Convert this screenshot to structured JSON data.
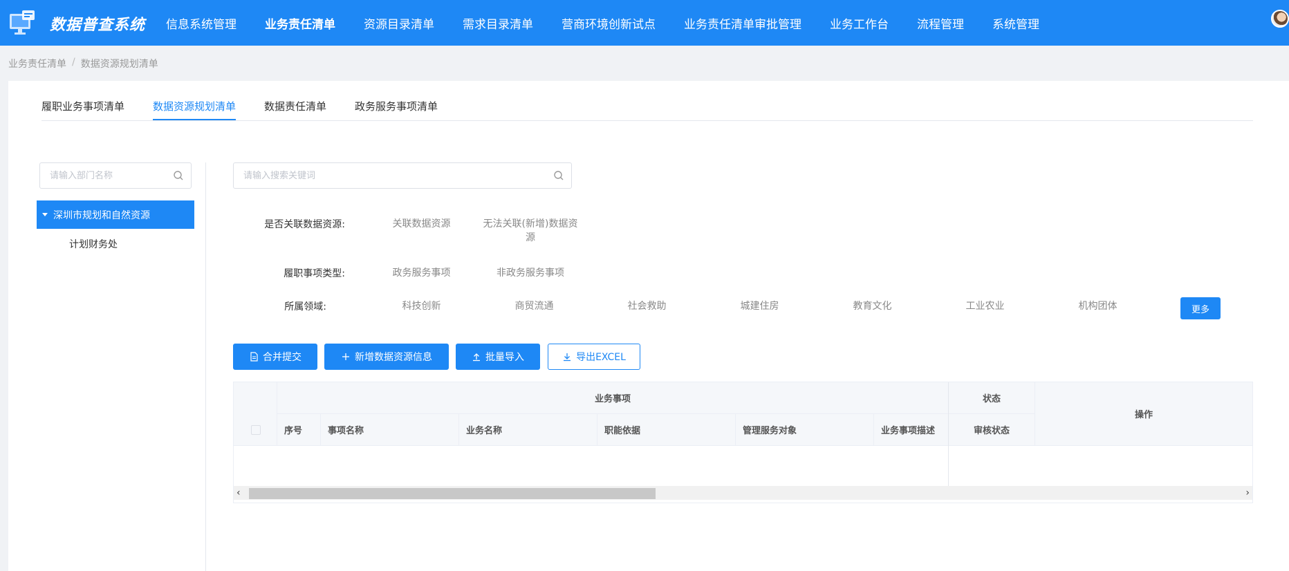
{
  "app": {
    "title": "数据普查系统"
  },
  "nav": [
    "信息系统管理",
    "业务责任清单",
    "资源目录清单",
    "需求目录清单",
    "营商环境创新试点",
    "业务责任清单审批管理",
    "业务工作台",
    "流程管理",
    "系统管理"
  ],
  "nav_active": "业务责任清单",
  "breadcrumb": [
    "业务责任清单",
    "数据资源规划清单"
  ],
  "breadcrumb_sep": "/",
  "tabs": [
    "履职业务事项清单",
    "数据资源规划清单",
    "数据责任清单",
    "政务服务事项清单"
  ],
  "tabs_active": "数据资源规划清单",
  "dept_search": {
    "placeholder": "请输入部门名称"
  },
  "tree": {
    "root": "深圳市规划和自然资源",
    "children": [
      "计划财务处"
    ]
  },
  "keyword_search": {
    "placeholder": "请输入搜索关键词"
  },
  "filters": {
    "linked": {
      "label": "是否关联数据资源:",
      "options": [
        "关联数据资源",
        "无法关联(新增)数据资源"
      ]
    },
    "duty_type": {
      "label": "履职事项类型:",
      "options": [
        "政务服务事项",
        "非政务服务事项"
      ]
    },
    "domain": {
      "label": "所属领域:",
      "options": [
        "科技创新",
        "商贸流通",
        "社会救助",
        "城建住房",
        "教育文化",
        "工业农业",
        "机构团体"
      ],
      "more": "更多"
    }
  },
  "actions": {
    "merge": "合并提交",
    "add": "新增数据资源信息",
    "import": "批量导入",
    "export": "导出EXCEL"
  },
  "table": {
    "group_business": "业务事项",
    "group_status": "状态",
    "col_ops": "操作",
    "columns": [
      "序号",
      "事项名称",
      "业务名称",
      "职能依据",
      "管理服务对象",
      "业务事项描述"
    ],
    "status_col": "审核状态",
    "rows": []
  },
  "colors": {
    "primary": "#1e88f5"
  }
}
